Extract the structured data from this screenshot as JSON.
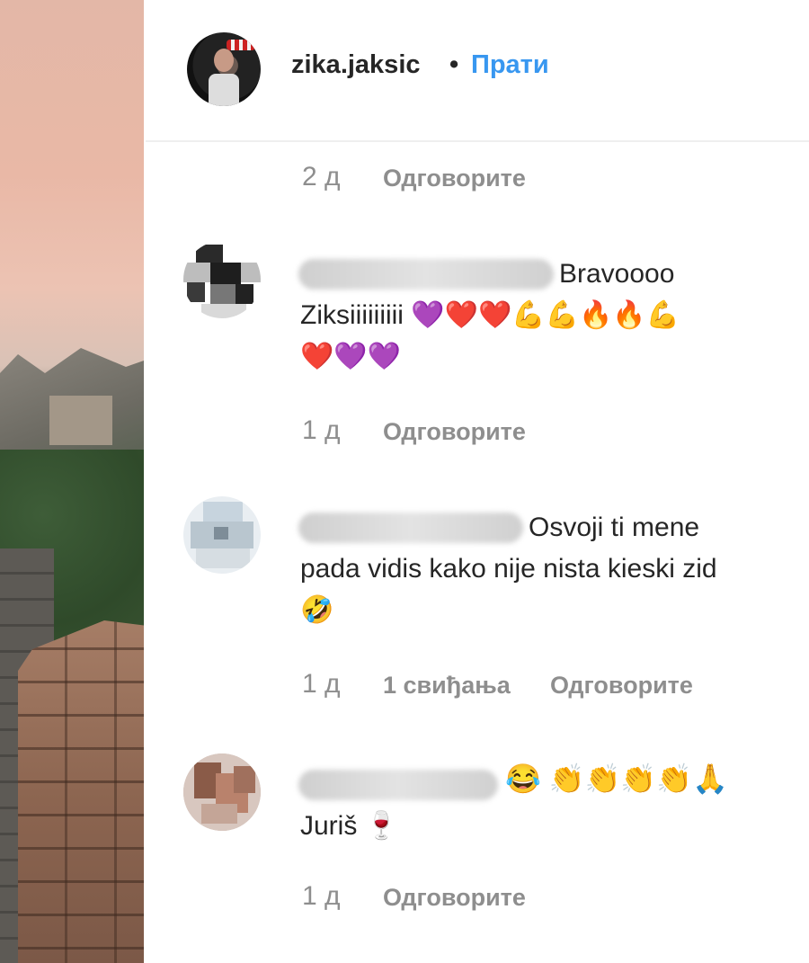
{
  "post": {
    "username": "zika.jaksic",
    "separator": "•",
    "follow_label": "Прати"
  },
  "first_meta": {
    "time": "2 д",
    "reply": "Одговорите"
  },
  "comments": [
    {
      "line1": "Bravoooo",
      "line2": "Ziksiiiiiiiii 💜❤️❤️💪💪🔥🔥💪",
      "line3": "❤️💜💜",
      "time": "1 д",
      "reply": "Одговорите"
    },
    {
      "line1": "Osvoji ti mene",
      "line2": "pada vidis kako nije nista kieski zid",
      "line3": "🤣",
      "time": "1 д",
      "likes": "1 свиђања",
      "reply": "Одговорите"
    },
    {
      "line1": "😂 👏👏👏👏🙏",
      "line2": "Juriš 🍷",
      "time": "1 д",
      "reply": "Одговорите"
    }
  ]
}
